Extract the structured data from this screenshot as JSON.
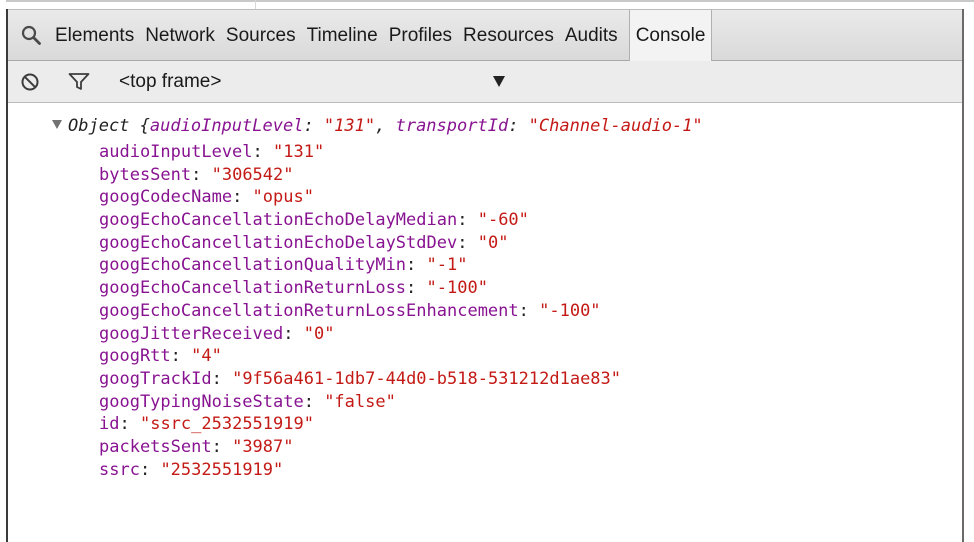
{
  "tabs": [
    {
      "label": "Elements"
    },
    {
      "label": "Network"
    },
    {
      "label": "Sources"
    },
    {
      "label": "Timeline"
    },
    {
      "label": "Profiles"
    },
    {
      "label": "Resources"
    },
    {
      "label": "Audits"
    },
    {
      "label": "Console",
      "active": true
    }
  ],
  "toolbar": {
    "frame_selector": "<top frame>"
  },
  "console": {
    "header": {
      "type_name": "Object",
      "open_brace": " {",
      "summary": [
        {
          "key": "audioInputLevel",
          "value": "\"131\"",
          "sep": ", "
        },
        {
          "key": "transportId",
          "value": "\"Channel-audio-1\"",
          "sep": ""
        }
      ]
    },
    "properties": [
      {
        "key": "audioInputLevel",
        "value": "\"131\""
      },
      {
        "key": "bytesSent",
        "value": "\"306542\""
      },
      {
        "key": "googCodecName",
        "value": "\"opus\""
      },
      {
        "key": "googEchoCancellationEchoDelayMedian",
        "value": "\"-60\""
      },
      {
        "key": "googEchoCancellationEchoDelayStdDev",
        "value": "\"0\""
      },
      {
        "key": "googEchoCancellationQualityMin",
        "value": "\"-1\""
      },
      {
        "key": "googEchoCancellationReturnLoss",
        "value": "\"-100\""
      },
      {
        "key": "googEchoCancellationReturnLossEnhancement",
        "value": "\"-100\""
      },
      {
        "key": "googJitterReceived",
        "value": "\"0\""
      },
      {
        "key": "googRtt",
        "value": "\"4\""
      },
      {
        "key": "googTrackId",
        "value": "\"9f56a461-1db7-44d0-b518-531212d1ae83\""
      },
      {
        "key": "googTypingNoiseState",
        "value": "\"false\""
      },
      {
        "key": "id",
        "value": "\"ssrc_2532551919\""
      },
      {
        "key": "packetsSent",
        "value": "\"3987\""
      },
      {
        "key": "ssrc",
        "value": "\"2532551919\""
      }
    ]
  },
  "icons": {
    "search": "search-icon",
    "clear": "clear-console-icon",
    "filter": "filter-icon",
    "dropdown": "dropdown-arrow-icon",
    "expand": "expand-triangle-icon"
  },
  "colors": {
    "property_key": "#881391",
    "string_value": "#c41a16",
    "tab_bar": "#e0e0e0",
    "toolbar": "#ececec"
  }
}
